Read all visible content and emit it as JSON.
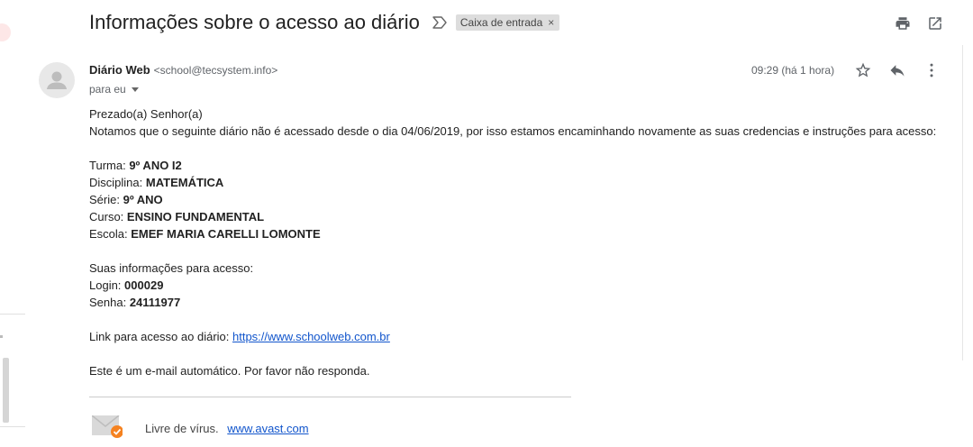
{
  "email": {
    "subject": "Informações sobre o acesso ao diário",
    "label": "Caixa de entrada",
    "sender_name": "Diário Web",
    "sender_email": "<school@tecsystem.info>",
    "recipient": "para eu",
    "time": "09:29 (há 1 hora)"
  },
  "body": {
    "greeting": "Prezado(a) Senhor(a)",
    "intro": "Notamos que o seguinte diário não é acessado desde o dia 04/06/2019, por isso estamos encaminhando novamente as suas credencias e instruções para acesso:",
    "fields": [
      {
        "label": "Turma:",
        "value": "9º ANO I2"
      },
      {
        "label": "Disciplina:",
        "value": "MATEMÁTICA"
      },
      {
        "label": "Série:",
        "value": "9º ANO"
      },
      {
        "label": "Curso:",
        "value": "ENSINO FUNDAMENTAL"
      },
      {
        "label": "Escola:",
        "value": "EMEF MARIA CARELLI LOMONTE"
      }
    ],
    "access_heading": "Suas informações para acesso:",
    "login_label": "Login:",
    "login_value": "000029",
    "password_label": "Senha:",
    "password_value": "24111977",
    "link_label": "Link para acesso ao diário:",
    "link_url": "https://www.schoolweb.com.br",
    "footer_note": "Este é um e-mail automático. Por favor não responda."
  },
  "signature": {
    "text": "Livre de vírus.",
    "link": "www.avast.com"
  },
  "icons": {
    "print": "print-icon",
    "open_new_window": "open-in-new-window-icon",
    "star": "star-icon",
    "reply": "reply-icon",
    "more": "more-vertical-icon",
    "important": "important-marker-icon",
    "avatar": "person-icon"
  },
  "colors": {
    "link": "#1155cc",
    "chip_bg": "#dddddd",
    "text": "#222222",
    "muted": "#5f6368"
  }
}
